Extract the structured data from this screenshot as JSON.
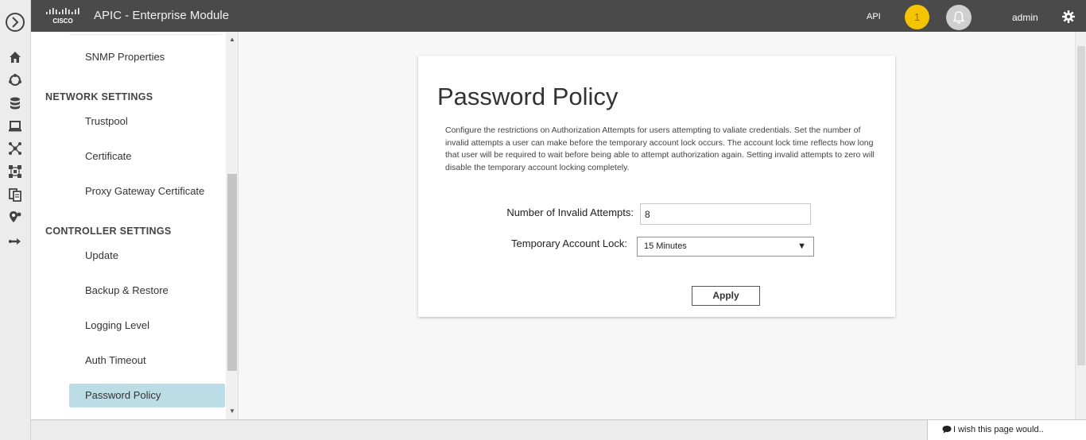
{
  "header": {
    "app_title": "APIC - Enterprise Module",
    "api_label": "API",
    "notification_count": "1",
    "user_name": "admin",
    "colors": {
      "bar": "#4a4a4a",
      "badge": "#f5c400"
    }
  },
  "rail": {
    "icons": [
      "expand-icon",
      "home-icon",
      "discovery-icon",
      "database-icon",
      "device-icon",
      "topology-icon",
      "network-icon",
      "documents-icon",
      "location-icon",
      "path-icon"
    ]
  },
  "sidebar": {
    "items_top": [
      "SNMP Properties"
    ],
    "sections": [
      {
        "title": "NETWORK SETTINGS",
        "items": [
          "Trustpool",
          "Certificate",
          "Proxy Gateway Certificate"
        ]
      },
      {
        "title": "CONTROLLER SETTINGS",
        "items": [
          "Update",
          "Backup & Restore",
          "Logging Level",
          "Auth Timeout",
          "Password Policy"
        ]
      }
    ],
    "active_item": "Password Policy",
    "active_color": "#bddde6"
  },
  "content": {
    "title": "Password Policy",
    "description": "Configure the restrictions on Authorization Attempts for users attempting to valiate credentials. Set the number of invalid attempts a user can make before the temporary account lock occurs. The account lock time reflects how long that user will be required to wait before being able to attempt authorization again. Setting invalid attempts to zero will disable the temporary account locking completely.",
    "invalid_attempts_label": "Number of Invalid Attempts:",
    "invalid_attempts_value": "8",
    "account_lock_label": "Temporary Account Lock:",
    "account_lock_value": "15 Minutes",
    "apply_label": "Apply"
  },
  "footer": {
    "feedback_label": "I wish this page would.."
  }
}
